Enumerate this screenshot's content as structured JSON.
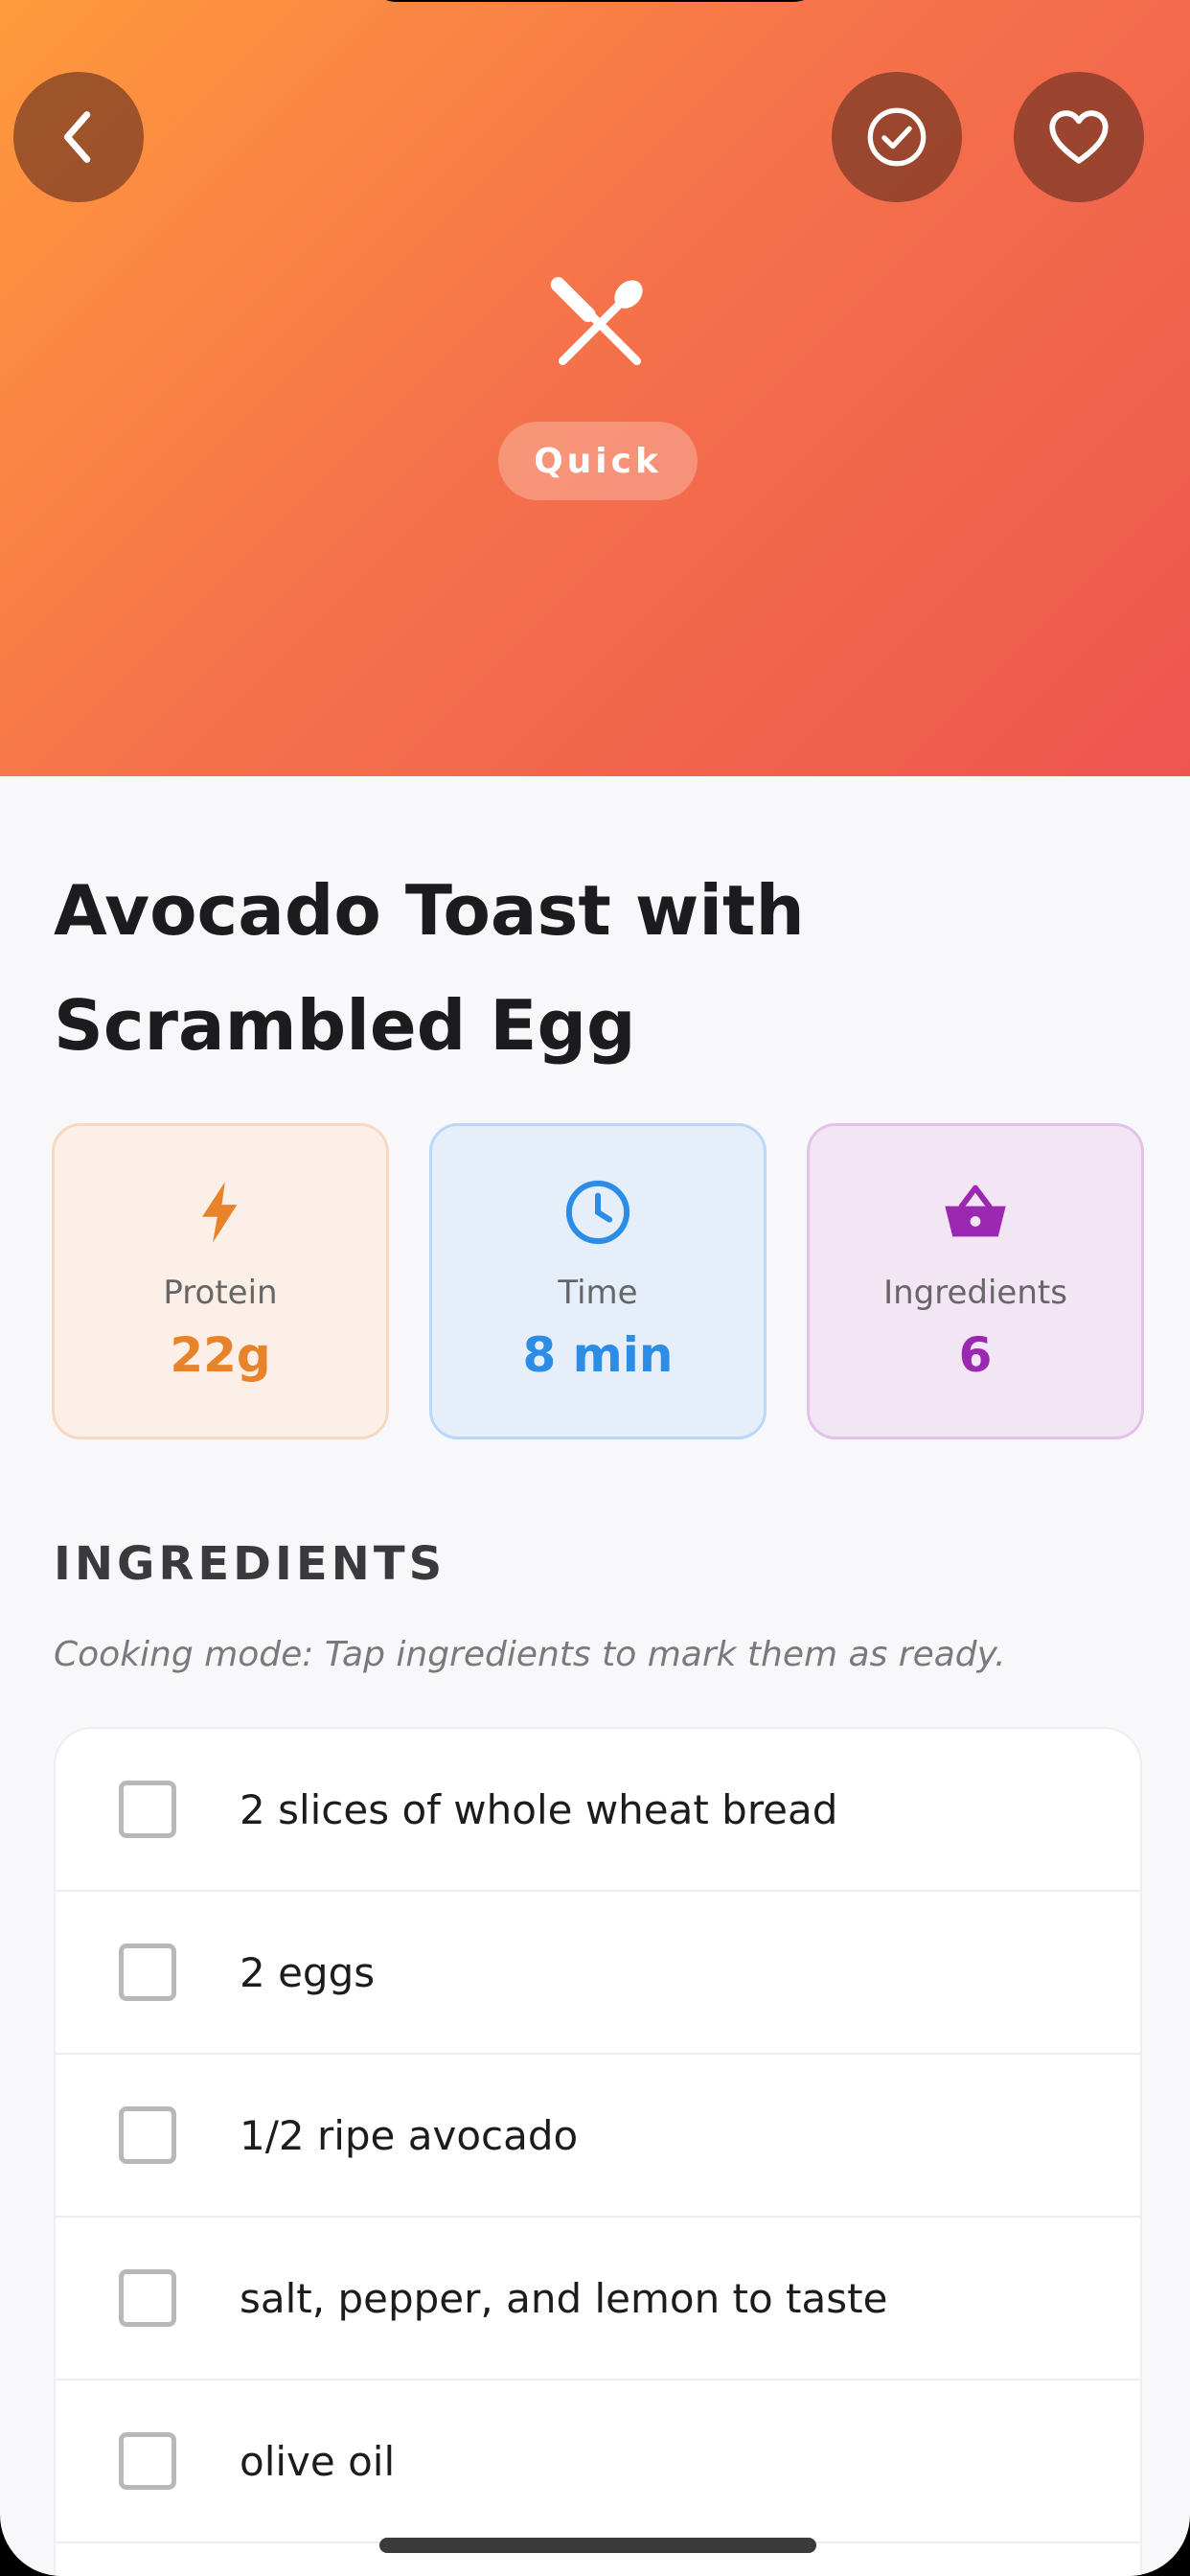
{
  "header": {
    "tag": "Quick"
  },
  "recipe": {
    "title_line1": "Avocado Toast with",
    "title_line2": "Scrambled Egg"
  },
  "stats": [
    {
      "label": "Protein",
      "value": "22g",
      "icon": "bolt-icon",
      "color": "#e8832a"
    },
    {
      "label": "Time",
      "value": "8 min",
      "icon": "clock-icon",
      "color": "#2b8de6"
    },
    {
      "label": "Ingredients",
      "value": "6",
      "icon": "basket-icon",
      "color": "#9c27b0"
    }
  ],
  "ingredients_section": {
    "heading": "INGREDIENTS",
    "hint": "Cooking mode: Tap ingredients to mark them as ready.",
    "items": [
      {
        "text": "2 slices of whole wheat bread",
        "checked": false
      },
      {
        "text": "2 eggs",
        "checked": false
      },
      {
        "text": "1/2 ripe avocado",
        "checked": false
      },
      {
        "text": "salt, pepper, and lemon to taste",
        "checked": false
      },
      {
        "text": "olive oil",
        "checked": false
      }
    ]
  },
  "colors": {
    "hero_gradient_start": "#ff9a3c",
    "hero_gradient_end": "#ee5550",
    "background": "#f8f8fb"
  }
}
